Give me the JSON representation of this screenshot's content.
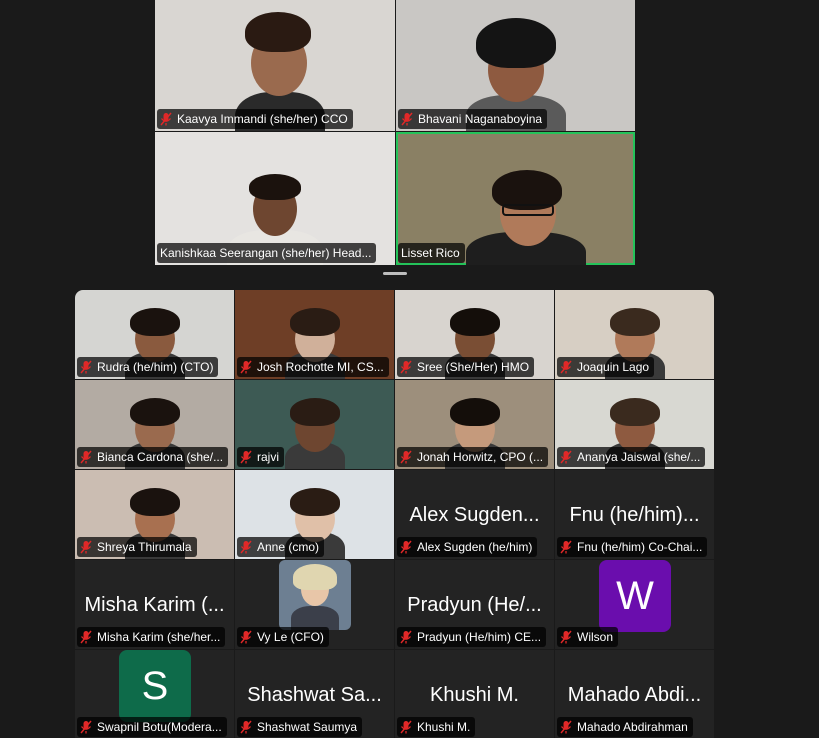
{
  "gallery": {
    "top": [
      {
        "name": "Kaavya Immandi (she/her) CCO",
        "bg": "#d9d6d2"
      },
      {
        "name": "Bhavani Naganaboyina",
        "bg": "#c9c7c4"
      },
      {
        "name": "Kanishkaa Seerangan (she/her) Head...",
        "bg": "#e4e2e0"
      },
      {
        "name": "Lisset Rico",
        "bg": "#8a8064",
        "active": true
      }
    ],
    "grid": [
      {
        "name": "Rudra (he/him) (CTO)",
        "type": "video",
        "bg": "#d5d5d2"
      },
      {
        "name": "Josh Rochotte MI, CS...",
        "type": "video",
        "bg": "#6e3e26"
      },
      {
        "name": "Sree (She/Her) HMO",
        "type": "video",
        "bg": "#d8d4cf"
      },
      {
        "name": "Joaquin Lago",
        "type": "video",
        "bg": "#d7cfc4"
      },
      {
        "name": "Bianca Cardona (she/...",
        "type": "video",
        "bg": "#b3aba3"
      },
      {
        "name": "rajvi",
        "type": "video",
        "bg": "#3d5a54"
      },
      {
        "name": "Jonah Horwitz, CPO (...",
        "type": "video",
        "bg": "#9d8f7c"
      },
      {
        "name": "Ananya Jaiswal (she/...",
        "type": "video",
        "bg": "#d8d8d2"
      },
      {
        "name": "Shreya Thirumala",
        "type": "video",
        "bg": "#cbbdb2"
      },
      {
        "name": "Anne (cmo)",
        "type": "video",
        "bg": "#dde2e6"
      },
      {
        "name": "Alex Sugden (he/him)",
        "type": "name",
        "big": "Alex Sugden..."
      },
      {
        "name": "Fnu (he/him) Co-Chai...",
        "type": "name",
        "big": "Fnu (he/him)..."
      },
      {
        "name": "Misha Karim (she/her...",
        "type": "name",
        "big": "Misha Karim (..."
      },
      {
        "name": "Vy Le (CFO)",
        "type": "photo"
      },
      {
        "name": "Pradyun (He/him) CE...",
        "type": "name",
        "big": "Pradyun (He/..."
      },
      {
        "name": "Wilson",
        "type": "letter",
        "letter": "W",
        "color": "#6a0dad"
      },
      {
        "name": "Swapnil Botu(Modera...",
        "type": "letter",
        "letter": "S",
        "color": "#0e6b4a"
      },
      {
        "name": "Shashwat Saumya",
        "type": "name",
        "big": "Shashwat Sa..."
      },
      {
        "name": "Khushi M.",
        "type": "name",
        "big": "Khushi M."
      },
      {
        "name": "Mahado Abdirahman",
        "type": "name",
        "big": "Mahado Abdi..."
      }
    ]
  },
  "icons": {
    "muted_mic": "muted-mic-icon"
  },
  "colors": {
    "active_speaker": "#24c35a",
    "muted": "#e02828",
    "background": "#1a1a1a"
  }
}
